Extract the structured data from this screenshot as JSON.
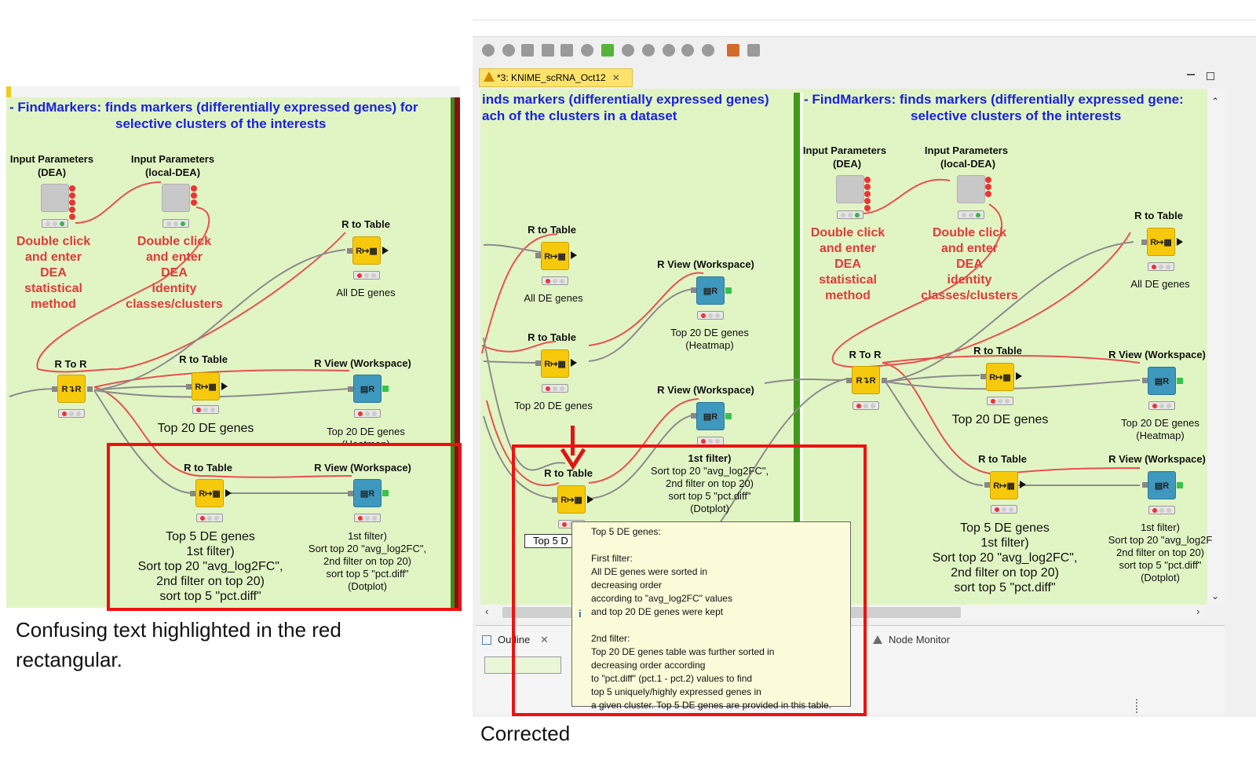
{
  "left_panel": {
    "annotation_line1": "- FindMarkers: finds markers (differentially expressed genes) for",
    "annotation_line2": "selective clusters of the interests",
    "input_dea": {
      "label1": "Input Parameters",
      "label2": "(DEA)"
    },
    "input_local_dea": {
      "label1": "Input Parameters",
      "label2": "(local-DEA)"
    },
    "red_note_1": [
      "Double click",
      "and enter",
      "DEA",
      "statistical",
      "method"
    ],
    "red_note_2": [
      "Double click",
      "and enter",
      "DEA",
      "identity",
      "classes/clusters"
    ],
    "r_to_table_top": {
      "label": "R to Table",
      "caption": "All DE genes"
    },
    "r_to_r": {
      "label": "R To R"
    },
    "r_to_table_mid": {
      "label": "R to Table",
      "caption": "Top 20 DE genes"
    },
    "r_view_mid": {
      "label": "R View (Workspace)",
      "caption": "Top 20 DE genes",
      "caption2": "(Heatmap)"
    },
    "r_to_table_bot": {
      "label": "R to Table",
      "caption": [
        "Top 5 DE genes",
        "1st filter)",
        "Sort top 20 \"avg_log2FC\",",
        "2nd filter on top 20)",
        "sort top 5 \"pct.diff\""
      ]
    },
    "r_view_bot": {
      "label": "R View (Workspace)",
      "caption": [
        "1st filter)",
        "Sort top 20 \"avg_log2FC\",",
        "2nd filter on top 20)",
        "sort top 5 \"pct.diff\"",
        "(Dotplot)"
      ]
    },
    "footer": [
      "Confusing text highlighted in the red",
      "rectangular."
    ]
  },
  "right_panel": {
    "tab_title": "*3: KNIME_scRNA_Oct12",
    "annotation_left_1": "inds markers (differentially expressed genes)",
    "annotation_left_2": "ach of the clusters in a dataset",
    "annotation_right_1": "- FindMarkers: finds markers (differentially expressed gene:",
    "annotation_right_2": "selective clusters of the interests",
    "rtt_a": {
      "label": "R to Table",
      "caption": "All DE genes"
    },
    "rtt_b": {
      "label": "R to Table",
      "caption": "Top 20 DE genes"
    },
    "rv_a": {
      "label": "R View (Workspace)",
      "caption": "Top 20 DE genes",
      "caption2": "(Heatmap)"
    },
    "rv_b": {
      "label": "R View (Workspace)",
      "caption": [
        "1st filter)",
        "Sort top 20 \"avg_log2FC\",",
        "2nd filter on top 20)",
        "sort top 5 \"pct.diff\"",
        "(Dotplot)"
      ]
    },
    "rtt_c": {
      "label": "R to Table",
      "caption": "Top 5 D"
    },
    "input_dea": {
      "label1": "Input Parameters",
      "label2": "(DEA)"
    },
    "input_local_dea": {
      "label1": "Input Parameters",
      "label2": "(local-DEA)"
    },
    "red_note_1": [
      "Double click",
      "and enter",
      "DEA",
      "statistical",
      "method"
    ],
    "red_note_2": [
      "Double click",
      "and enter",
      "DEA",
      "identity",
      "classes/clusters"
    ],
    "rtt_top": {
      "label": "R to Table",
      "caption": "All DE genes"
    },
    "r_to_r": {
      "label": "R To R"
    },
    "rtt_mid": {
      "label": "R to Table",
      "caption": "Top 20 DE genes"
    },
    "rv_mid": {
      "label": "R View (Workspace)",
      "caption": "Top 20 DE genes",
      "caption2": "(Heatmap)"
    },
    "rtt_bot": {
      "label": "R to Table",
      "caption": [
        "Top 5 DE genes",
        "1st filter)",
        "Sort top 20 \"avg_log2FC\",",
        "2nd filter on top 20)",
        "sort top 5 \"pct.diff\""
      ]
    },
    "rv_bot": {
      "label": "R View (Workspace)",
      "caption": [
        "1st filter)",
        "Sort top 20 \"avg_log2F",
        "2nd filter on top 20)",
        "sort top 5 \"pct.diff\"",
        "(Dotplot)"
      ]
    },
    "tooltip": [
      "Top 5 DE genes:",
      "",
      "First filter:",
      "All DE genes were sorted in",
      "decreasing order",
      "according to \"avg_log2FC\" values",
      "and top 20 DE genes were kept",
      "",
      " 2nd filter:",
      "Top 20 DE genes table was further sorted in",
      " decreasing order according",
      "to  \"pct.diff\" (pct.1 - pct.2) values to find",
      "top 5 uniquely/highly expressed genes in",
      "a given cluster. Top 5 DE genes are provided in this table."
    ],
    "outline_tab": "Outline",
    "node_monitor_tab": "Node Monitor",
    "footer": "Corrected"
  },
  "colors": {
    "canvas": "#e1f5c4",
    "annotation": "#1a22dd",
    "red_note": "#e03a3a",
    "highlight": "#ee1111"
  }
}
